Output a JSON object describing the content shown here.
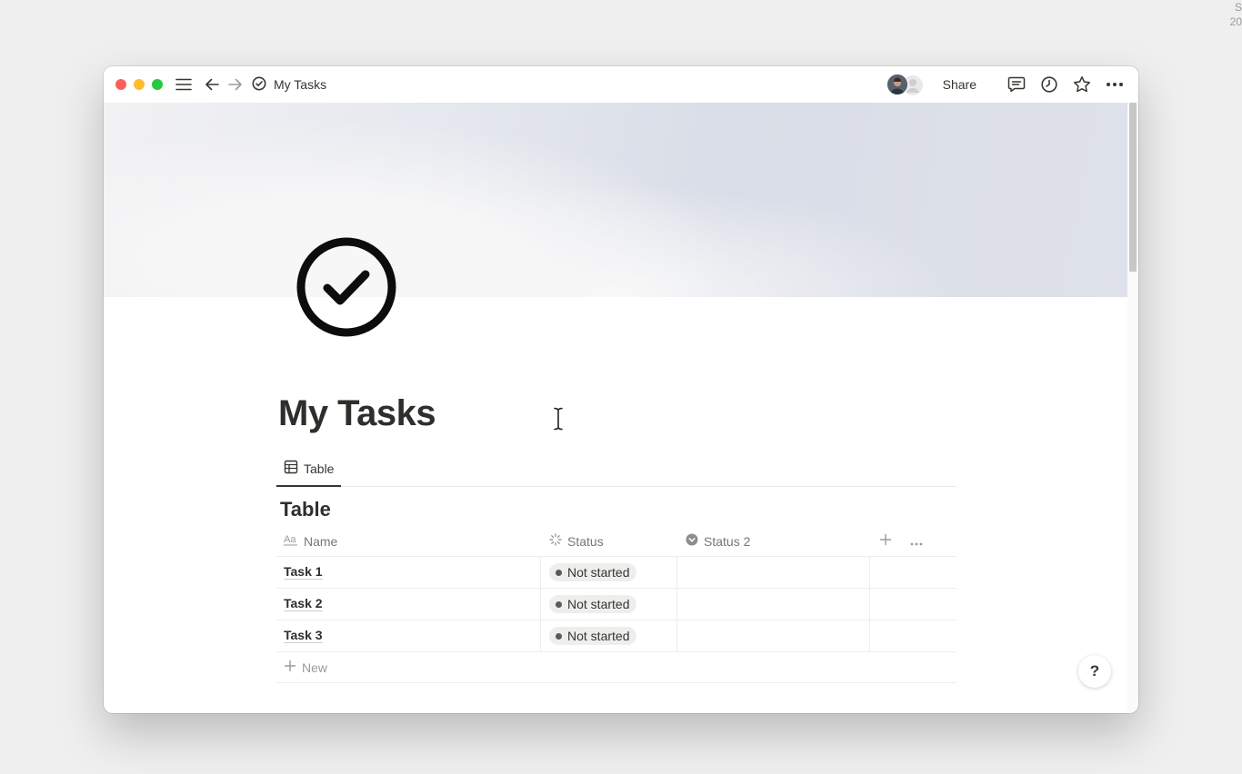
{
  "window": {
    "page_title": "My Tasks",
    "share_label": "Share"
  },
  "page": {
    "title": "My Tasks",
    "icon": "check-circle-icon"
  },
  "views": [
    {
      "label": "Table",
      "icon": "table-icon",
      "active": true
    }
  ],
  "database": {
    "title": "Table",
    "columns": [
      {
        "label": "Name",
        "icon": "text-aa-icon"
      },
      {
        "label": "Status",
        "icon": "status-spinner-icon"
      },
      {
        "label": "Status 2",
        "icon": "status-chevron-icon"
      }
    ],
    "rows": [
      {
        "name": "Task 1",
        "status": "Not started",
        "status2": ""
      },
      {
        "name": "Task 2",
        "status": "Not started",
        "status2": ""
      },
      {
        "name": "Task 3",
        "status": "Not started",
        "status2": ""
      }
    ],
    "new_label": "New"
  },
  "help": {
    "label": "?"
  },
  "corner": {
    "text": "S\n20"
  },
  "colors": {
    "traffic_red": "#fe5f57",
    "traffic_yellow": "#febc2e",
    "traffic_green": "#28c840",
    "pill_bg": "#eeeeed"
  }
}
